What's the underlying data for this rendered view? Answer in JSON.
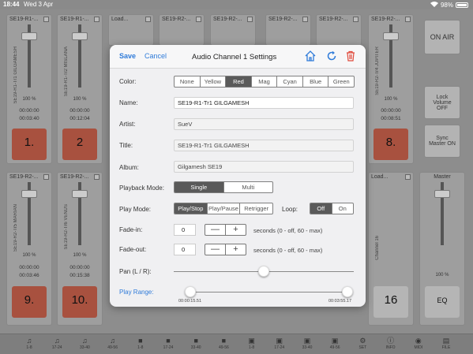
{
  "status": {
    "time": "18:44",
    "date": "Wed 3 Apr",
    "battery": "98%"
  },
  "strips": [
    {
      "title": "SE19-R1-...",
      "vlabel": "SE19-R1-Tr1 GILGAMESH",
      "pct": "100 %",
      "t1": "00:00:00",
      "t2": "00:03:40",
      "num": "1."
    },
    {
      "title": "SE19-R1-...",
      "vlabel": "SE19-R1-Tr2 MISLANA",
      "pct": "100 %",
      "t1": "00:00:00",
      "t2": "00:12:04",
      "num": "2"
    },
    {
      "title": "Load...",
      "vlabel": "",
      "pct": "",
      "t1": "",
      "t2": "",
      "num": ""
    },
    {
      "title": "SE19-R2-...",
      "vlabel": "",
      "pct": "",
      "t1": "",
      "t2": "",
      "num": ""
    },
    {
      "title": "SE19-R2-...",
      "vlabel": "",
      "pct": "",
      "t1": "",
      "t2": "",
      "num": ""
    },
    {
      "title": "SE19-R2-...",
      "vlabel": "",
      "pct": "",
      "t1": "",
      "t2": "",
      "num": ""
    },
    {
      "title": "SE19-R2-...",
      "vlabel": "",
      "pct": "",
      "t1": "",
      "t2": "",
      "num": ""
    },
    {
      "title": "SE19-R2-...",
      "vlabel": "SE19-R2-Tr4 JUPITER",
      "pct": "100 %",
      "t1": "00:00:00",
      "t2": "00:08:51",
      "num": "8."
    },
    {
      "title": "SE19-R2-...",
      "vlabel": "SE19-R2-Tr5 MARIAN",
      "pct": "100 %",
      "t1": "00:00:00",
      "t2": "00:03:46",
      "num": "9."
    },
    {
      "title": "SE19-R2-...",
      "vlabel": "SE19-R2-Tr6 VENUS",
      "pct": "100 %",
      "t1": "00:00:00",
      "t2": "00:15:38",
      "num": "10."
    },
    {
      "title": "Load...",
      "vlabel": "Channel 16",
      "pct": "",
      "t1": "",
      "t2": "",
      "num": "16"
    }
  ],
  "right_panel": {
    "on_air": "ON AIR",
    "lock_volume": "Lock Volume OFF",
    "sync_master": "Sync Master ON",
    "master": "Master",
    "master_pct": "100 %",
    "eq": "EQ"
  },
  "tabbar": [
    "1-8",
    "17-24",
    "33-40",
    "49-56",
    "1-8",
    "17-24",
    "33-40",
    "49-56",
    "1-8",
    "17-24",
    "33-40",
    "49-56",
    "SET",
    "INFO",
    "MIDI",
    "FILE"
  ],
  "dialog": {
    "save": "Save",
    "cancel": "Cancel",
    "title": "Audio Channel 1 Settings",
    "color_label": "Color:",
    "colors": [
      "None",
      "Yellow",
      "Red",
      "Mag",
      "Cyan",
      "Blue",
      "Green"
    ],
    "selected_color": "Red",
    "name_label": "Name:",
    "name_value": "SE19-R1-Tr1 GILGAMESH",
    "artist_label": "Artist:",
    "artist_value": "SueV",
    "title_label": "Title:",
    "title_value": "SE19-R1-Tr1 GILGAMESH",
    "album_label": "Album:",
    "album_value": "Gilgamesh SE19",
    "playback_mode_label": "Playback Mode:",
    "playback_modes": [
      "Single",
      "Multi"
    ],
    "playback_selected": "Single",
    "play_mode_label": "Play Mode:",
    "play_modes": [
      "Play/Stop",
      "Play/Pause",
      "Retrigger"
    ],
    "play_mode_selected": "Play/Stop",
    "loop_label": "Loop:",
    "loop_options": [
      "Off",
      "On"
    ],
    "loop_selected": "Off",
    "fade_in_label": "Fade-in:",
    "fade_in_value": "0",
    "fade_out_label": "Fade-out:",
    "fade_out_value": "0",
    "stepper_minus": "—",
    "stepper_plus": "+",
    "fade_hint": "seconds (0 - off, 60 - max)",
    "pan_label": "Pan (L / R):",
    "pan_value": 0.5,
    "play_range_label": "Play Range:",
    "range_start": "00:00:15.51",
    "range_end": "00:03:55.17",
    "accent_color": "#2f7bd9",
    "delete_color": "#e0483a"
  }
}
